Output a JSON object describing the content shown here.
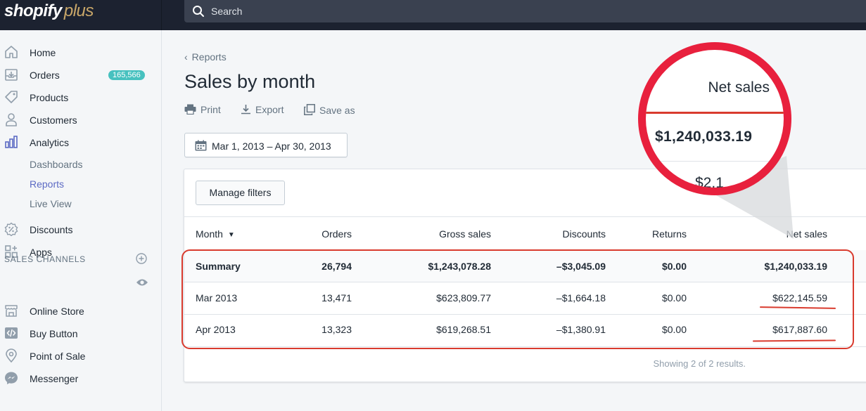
{
  "app": {
    "logo_text": "shopify",
    "logo_suffix": "plus",
    "search_placeholder": "Search"
  },
  "colors": {
    "accent": "#5c6ac4",
    "badge": "#47c1bf",
    "highlight": "#d93b2e",
    "lens": "#e8203d",
    "topbar": "#1c2230"
  },
  "sidebar": {
    "items": [
      {
        "label": "Home",
        "icon": "home-icon"
      },
      {
        "label": "Orders",
        "icon": "orders-icon",
        "badge": "165,566"
      },
      {
        "label": "Products",
        "icon": "tag-icon"
      },
      {
        "label": "Customers",
        "icon": "person-icon"
      },
      {
        "label": "Analytics",
        "icon": "bar-chart-icon"
      }
    ],
    "analytics_sub": [
      {
        "label": "Dashboards"
      },
      {
        "label": "Reports"
      },
      {
        "label": "Live View"
      }
    ],
    "more_items": [
      {
        "label": "Discounts",
        "icon": "discount-icon"
      },
      {
        "label": "Apps",
        "icon": "apps-icon"
      }
    ],
    "channels_header": "SALES CHANNELS",
    "channels": [
      {
        "label": "Online Store",
        "icon": "store-icon"
      },
      {
        "label": "Buy Button",
        "icon": "code-icon"
      },
      {
        "label": "Point of Sale",
        "icon": "location-pin-icon"
      },
      {
        "label": "Messenger",
        "icon": "messenger-icon"
      }
    ]
  },
  "page": {
    "breadcrumb": "Reports",
    "title": "Sales by month",
    "actions": {
      "print": "Print",
      "export": "Export",
      "save_as": "Save as"
    },
    "date_range": "Mar 1, 2013 – Apr 30, 2013",
    "manage_filters": "Manage filters",
    "footer": "Showing 2 of 2 results."
  },
  "table": {
    "columns": [
      "Month",
      "Orders",
      "Gross sales",
      "Discounts",
      "Returns",
      "Net sales"
    ],
    "summary": {
      "month": "Summary",
      "orders": "26,794",
      "gross": "$1,243,078.28",
      "discounts": "–$3,045.09",
      "returns": "$0.00",
      "net": "$1,240,033.19"
    },
    "rows": [
      {
        "month": "Mar 2013",
        "orders": "13,471",
        "gross": "$623,809.77",
        "discounts": "–$1,664.18",
        "returns": "$0.00",
        "net": "$622,145.59"
      },
      {
        "month": "Apr 2013",
        "orders": "13,323",
        "gross": "$619,268.51",
        "discounts": "–$1,380.91",
        "returns": "$0.00",
        "net": "$617,887.60"
      }
    ]
  },
  "magnifier": {
    "header": "Net sales",
    "value": "$1,240,033.19",
    "partial": "$2,1"
  }
}
